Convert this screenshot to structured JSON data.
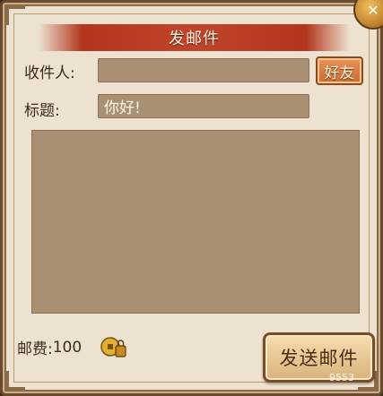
{
  "dialog": {
    "title": "发邮件",
    "close_symbol": "✕"
  },
  "form": {
    "recipient_label": "收件人:",
    "recipient_value": "",
    "friends_button": "好友",
    "subject_label": "标题:",
    "subject_value": "你好!",
    "body_value": ""
  },
  "footer": {
    "postage_label": "邮费:",
    "postage_amount": "100",
    "currency_icon": "coin-icon",
    "send_button": "发送邮件"
  },
  "watermark": "9553",
  "colors": {
    "panel_bg": "#ece2cf",
    "field_bg": "#a99073",
    "title_red": "#b2361e",
    "text_brown": "#3d2a18"
  }
}
